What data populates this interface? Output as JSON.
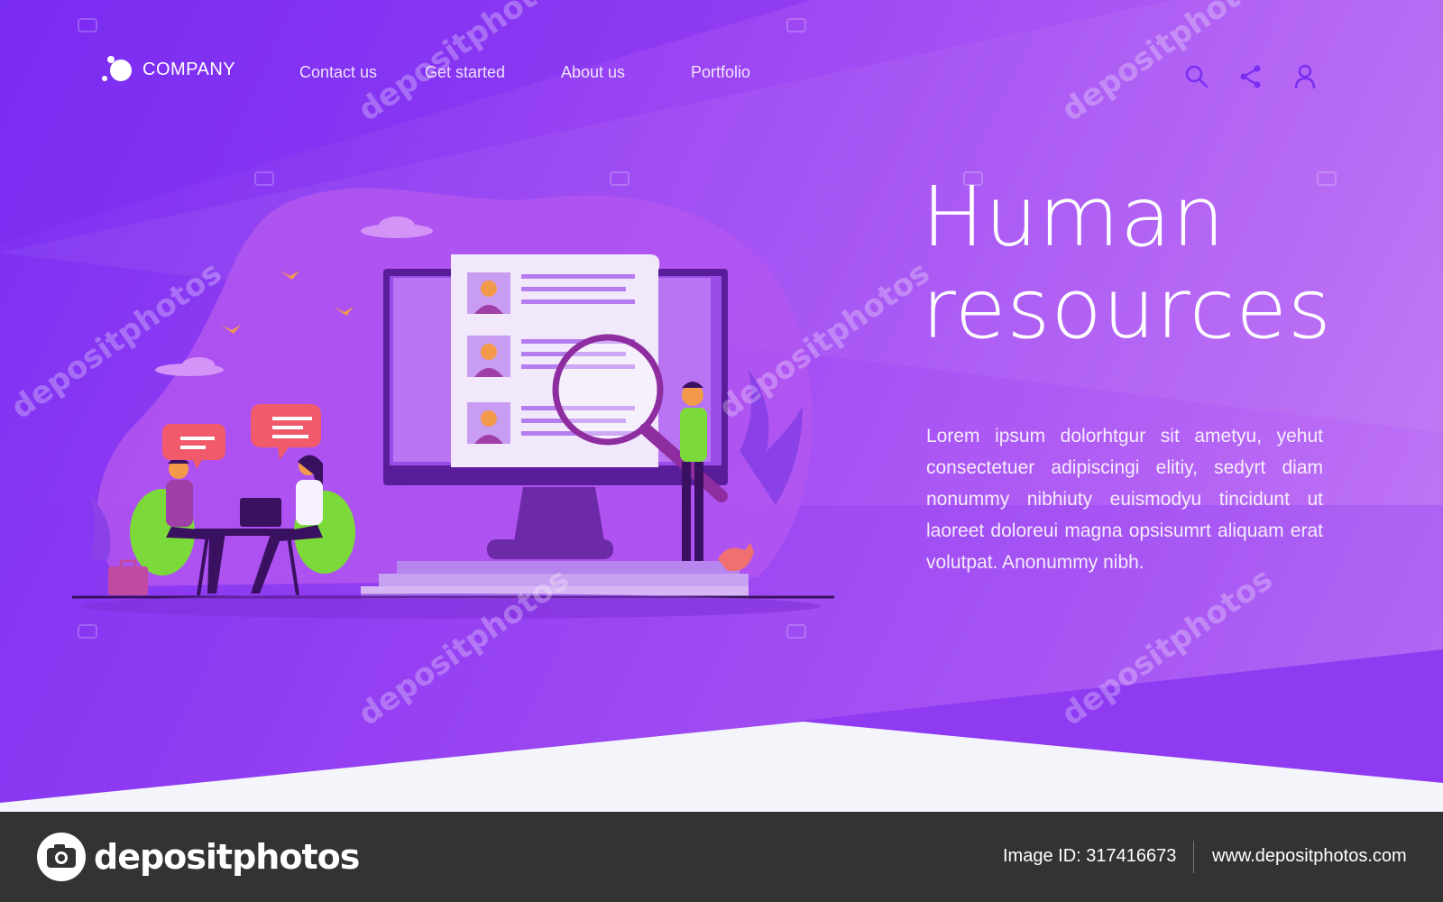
{
  "brand": {
    "name": "COMPANY"
  },
  "nav": {
    "links": [
      "Contact us",
      "Get started",
      "About us",
      "Portfolio"
    ],
    "icons": [
      "search-icon",
      "share-icon",
      "user-icon"
    ]
  },
  "hero": {
    "title_line1": "Human",
    "title_line2": "resources",
    "body": "Lorem ipsum dolorhtgur sit ametyu, yehut consectetuer adipiscingi elitiy, sedyrt diam nonummy nibhiuty euismodyu tincidunt ut laoreet doloreui magna opsisumrt aliquam erat volutpat. Anonummy nibh."
  },
  "watermark": {
    "text": "depositphotos"
  },
  "footer": {
    "logo_text": "depositphotos",
    "image_id": "Image ID: 317416673",
    "url": "www.depositphotos.com"
  },
  "colors": {
    "background_start": "#7a2ef2",
    "background_end": "#c47cf6",
    "footer": "#333333",
    "accent_green": "#7bd93a",
    "accent_orange": "#f39a4a"
  }
}
